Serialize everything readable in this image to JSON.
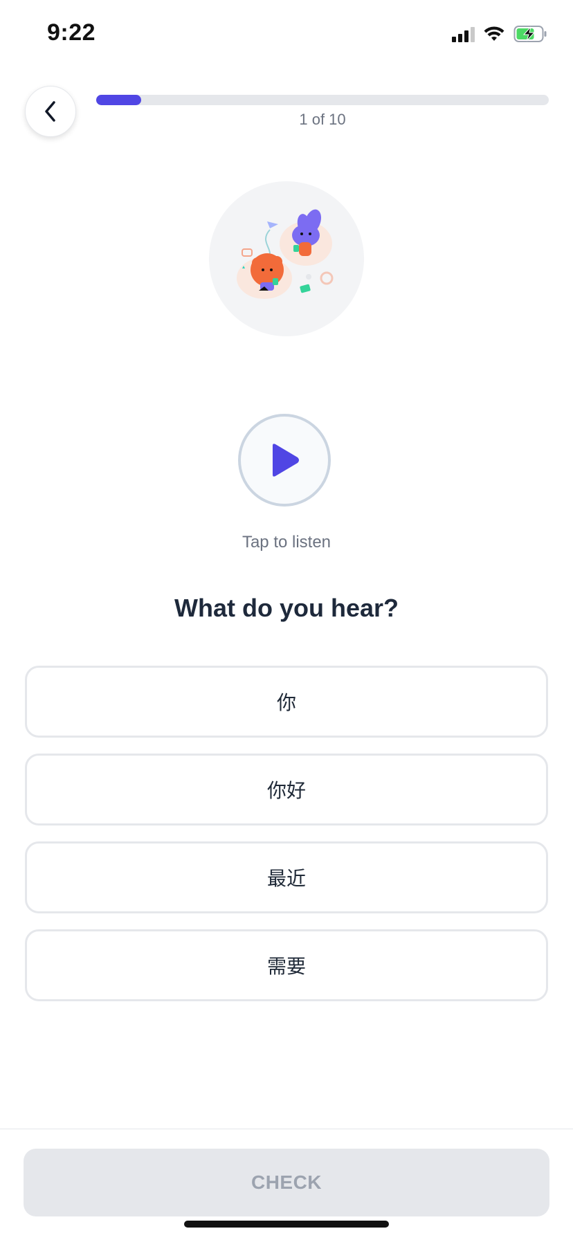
{
  "status_bar": {
    "time": "9:22",
    "icons": [
      "cellular-signal-icon",
      "wifi-icon",
      "battery-charging-icon"
    ],
    "battery_color": "#4cd964"
  },
  "header": {
    "back_icon": "chevron-left-icon",
    "progress_fraction": 0.1,
    "progress_label": "1 of 10"
  },
  "illustration": {
    "name": "lesson-illustration"
  },
  "audio": {
    "play_icon": "play-icon",
    "tap_label": "Tap to listen"
  },
  "question": "What do you hear?",
  "options": [
    {
      "label": "你"
    },
    {
      "label": "你好"
    },
    {
      "label": "最近"
    },
    {
      "label": "需要"
    }
  ],
  "footer": {
    "check_label": "CHECK"
  },
  "colors": {
    "accent": "#5046e4",
    "disabled_button": "#e5e7eb",
    "disabled_text": "#9ca3af"
  }
}
